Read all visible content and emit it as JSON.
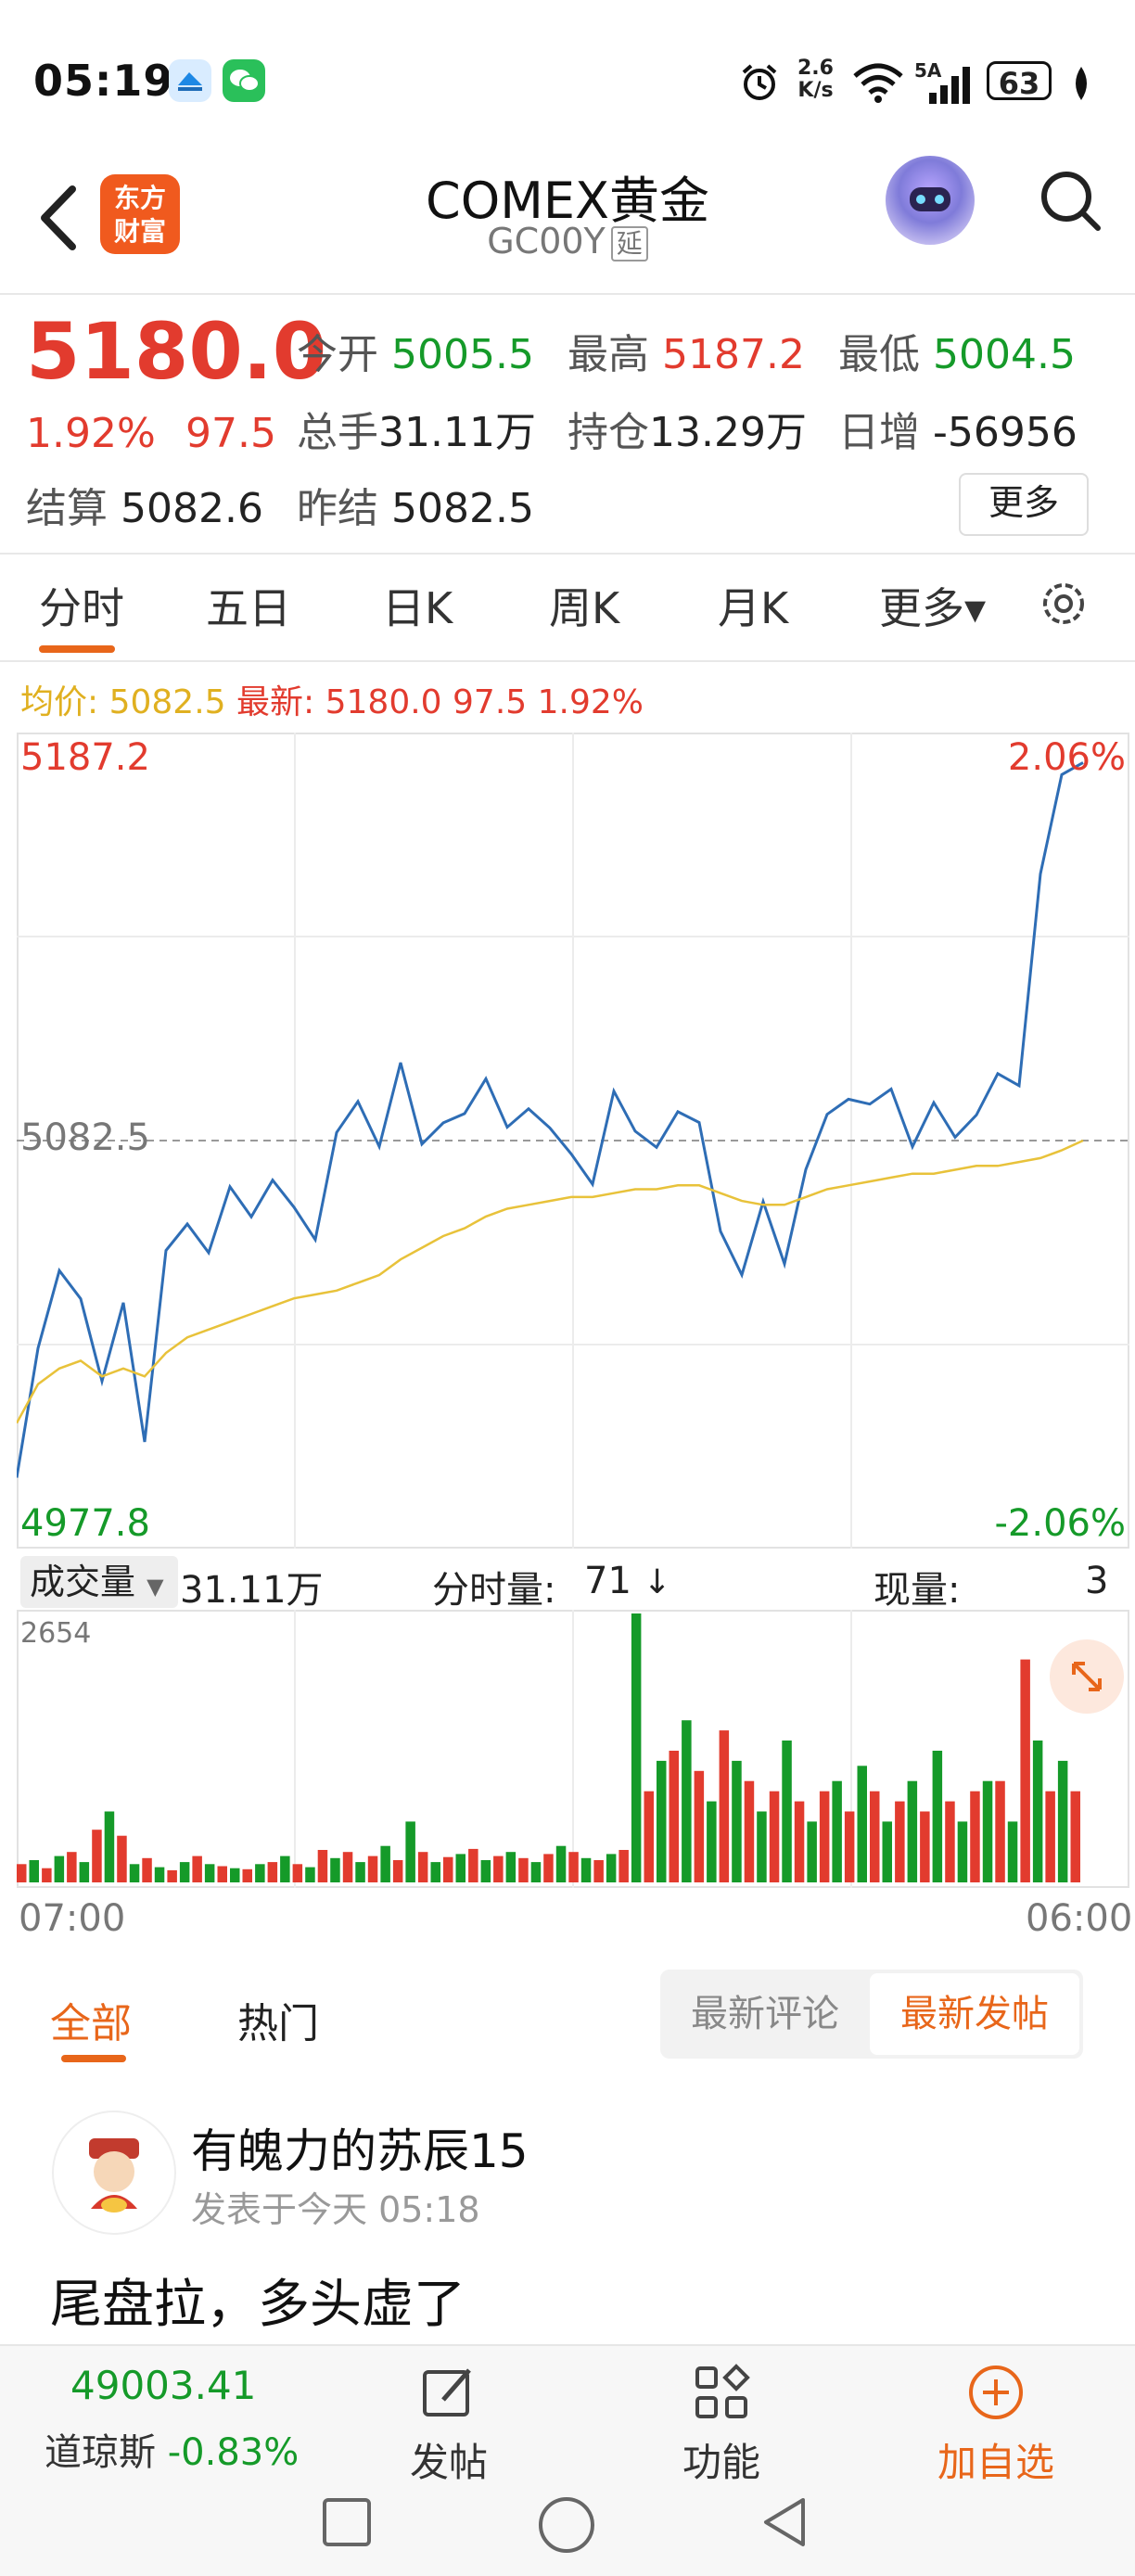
{
  "status_bar": {
    "time": "05:19",
    "net_speed_top": "2.6",
    "net_speed_bottom": "K/s",
    "signal_label": "5A",
    "battery": "63"
  },
  "header": {
    "back_icon": "chevron-left-icon",
    "app_logo_line1": "东方",
    "app_logo_line2": "财富",
    "title": "COMEX黄金",
    "subtitle": "GC00Y",
    "delay_tag": "延"
  },
  "quote": {
    "price": "5180.0",
    "change_pct": "1.92%",
    "change_abs": "97.5",
    "open_label": "今开",
    "open": "5005.5",
    "high_label": "最高",
    "high": "5187.2",
    "low_label": "最低",
    "low": "5004.5",
    "volume_label": "总手",
    "volume": "31.11万",
    "oi_label": "持仓",
    "oi": "13.29万",
    "daily_inc_label": "日增",
    "daily_inc": "-56956",
    "settle_label": "结算",
    "settle": "5082.6",
    "prev_settle_label": "昨结",
    "prev_settle": "5082.5",
    "more": "更多"
  },
  "tabs": [
    "分时",
    "五日",
    "日K",
    "周K",
    "月K",
    "更多▾"
  ],
  "avg_line": {
    "avg_label": "均价:",
    "avg_value": "5082.5",
    "latest_label": "最新:",
    "latest_value": "5180.0 97.5 1.92%"
  },
  "chart_data": {
    "type": "line",
    "title": "",
    "y_top_label": "5187.2",
    "y_mid_label": "5082.5",
    "y_bottom_label": "4977.8",
    "pct_top_label": "2.06%",
    "pct_bottom_label": "-2.06%",
    "ylim": [
      4977.8,
      5187.2
    ],
    "x_labels": [
      "07:00",
      "06:00"
    ],
    "series": [
      {
        "values": [
          4996,
          5030,
          5050,
          5042,
          5020,
          5040,
          5005,
          5055,
          5062,
          5054,
          5070,
          5062,
          5072,
          5066,
          5058,
          5085,
          5092,
          5080,
          5102,
          5082,
          5088,
          5090,
          5098,
          5085,
          5090,
          5086,
          5080,
          5072,
          5095,
          5084,
          5080,
          5090,
          5088,
          5060,
          5048,
          5066,
          5050,
          5075,
          5090,
          5094,
          5092,
          5095,
          5080,
          5092,
          5084,
          5090,
          5100,
          5096,
          5150,
          5176,
          5180
        ]
      },
      {
        "values": [
          5010,
          5020,
          5024,
          5026,
          5022,
          5024,
          5022,
          5028,
          5032,
          5034,
          5036,
          5038,
          5040,
          5042,
          5043,
          5044,
          5046,
          5048,
          5052,
          5055,
          5058,
          5060,
          5063,
          5065,
          5066,
          5067,
          5068,
          5068,
          5069,
          5070,
          5070,
          5071,
          5071,
          5069,
          5067,
          5066,
          5066,
          5068,
          5070,
          5071,
          5072,
          5073,
          5074,
          5074,
          5075,
          5076,
          5076,
          5077,
          5078,
          5080,
          5082.5
        ]
      }
    ]
  },
  "volume_bar": {
    "select_label": "成交量",
    "total": "31.11万",
    "minute_label": "分时量:",
    "minute_value": "71",
    "current_label": "现量:",
    "current_value": "3",
    "max_label": "2654"
  },
  "volume_chart": {
    "type": "bar",
    "ylim": [
      0,
      2654
    ],
    "values": [
      180,
      220,
      140,
      260,
      300,
      200,
      520,
      700,
      460,
      180,
      240,
      150,
      120,
      200,
      260,
      180,
      160,
      140,
      130,
      180,
      200,
      260,
      180,
      150,
      320,
      240,
      300,
      200,
      260,
      360,
      220,
      600,
      300,
      200,
      250,
      280,
      330,
      220,
      260,
      300,
      240,
      200,
      280,
      360,
      300,
      240,
      220,
      280,
      320,
      2654,
      900,
      1200,
      1300,
      1600,
      1100,
      800,
      1500,
      1200,
      1000,
      700,
      900,
      1400,
      800,
      600,
      900,
      1000,
      700,
      1150,
      900,
      600,
      800,
      1000,
      700,
      1300,
      800,
      600,
      900,
      1000,
      1000,
      600,
      2200,
      1400,
      900,
      1200,
      900
    ],
    "colors": [
      "#e23b2e",
      "#159a29"
    ]
  },
  "time_axis": {
    "start": "07:00",
    "end": "06:00"
  },
  "comments": {
    "tab_all": "全部",
    "tab_hot": "热门",
    "seg_latest_comment": "最新评论",
    "seg_latest_post": "最新发帖",
    "post": {
      "author": "有魄力的苏辰15",
      "time": "发表于今天 05:18",
      "text": "尾盘拉，多头虚了"
    }
  },
  "bottom_bar": {
    "index_value": "49003.41",
    "index_name": "道琼斯",
    "index_change": "-0.83%",
    "post_label": "发帖",
    "func_label": "功能",
    "watch_label": "加自选"
  },
  "colors": {
    "up": "#e23b2e",
    "down": "#159a29",
    "accent": "#e8661a",
    "price_line": "#2e6db5",
    "avg_line": "#e8c23a"
  }
}
